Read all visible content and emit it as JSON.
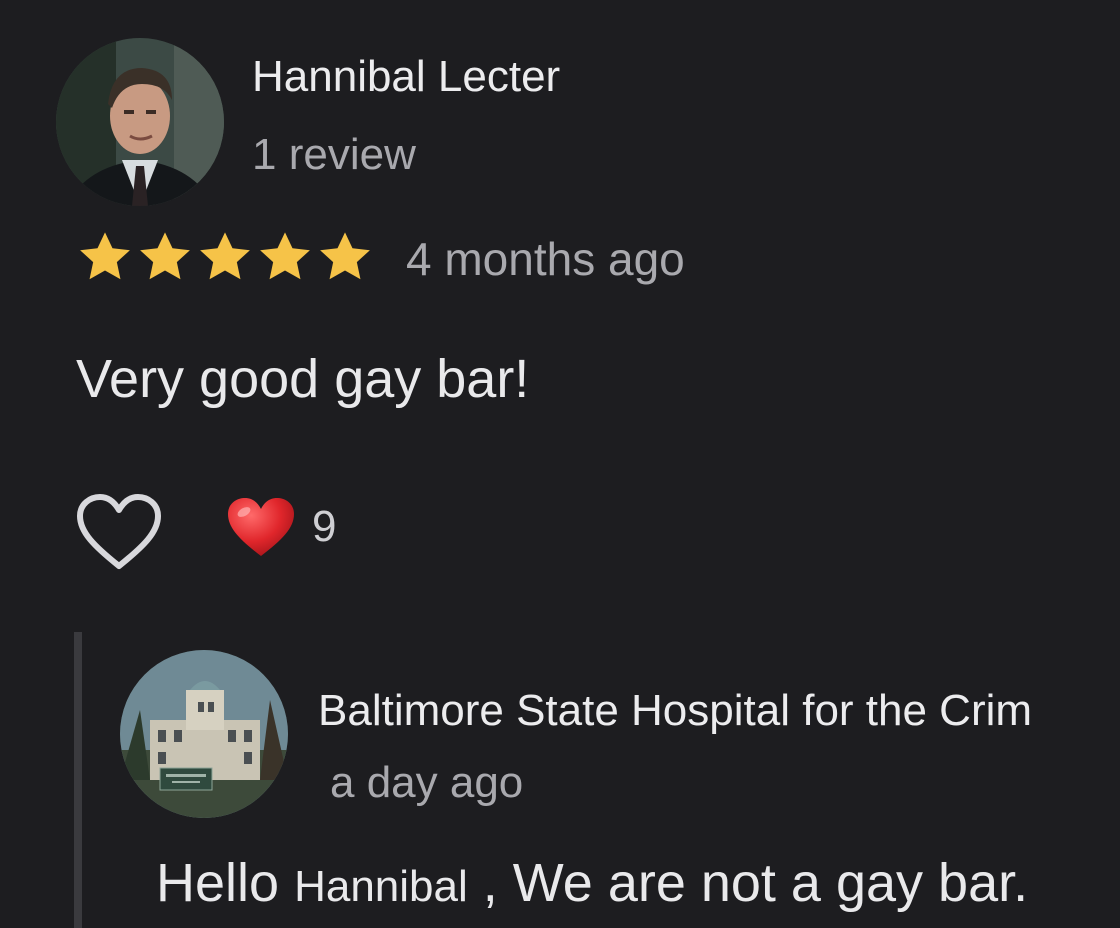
{
  "review": {
    "author": "Hannibal Lecter",
    "meta": "1 review",
    "rating": 5,
    "rating_max": 5,
    "time": "4 months ago",
    "text": "Very good gay bar!",
    "reaction_emoji": "heart",
    "reaction_count": "9"
  },
  "reply": {
    "author": "Baltimore State Hospital for the Crim",
    "time": "a day ago",
    "text_greeting": "Hello",
    "text_name": "Hannibal",
    "text_rest": ", We are not a gay bar."
  },
  "colors": {
    "background": "#1d1d20",
    "star": "#f6c348",
    "heart": "#e0262b",
    "secondary_text": "#a9a9ae"
  },
  "icons": {
    "like": "heart-outline-icon",
    "reaction": "red-heart-emoji-icon",
    "star": "star-icon"
  }
}
